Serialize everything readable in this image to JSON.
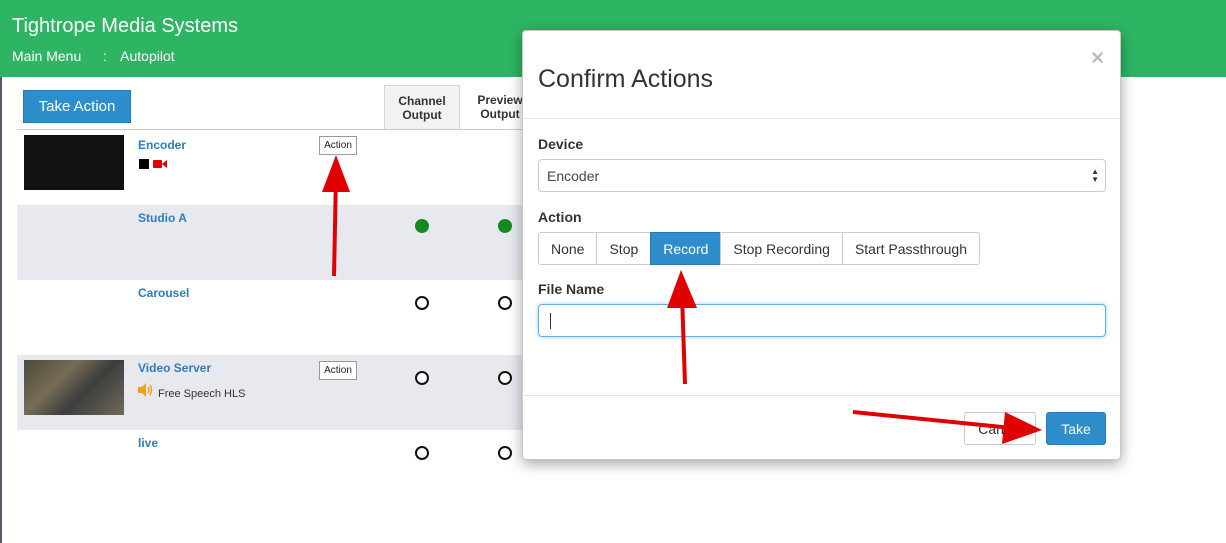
{
  "header": {
    "app_title": "Tightrope Media Systems",
    "breadcrumb": [
      "Main Menu",
      ":",
      "Autopilot"
    ]
  },
  "toolbar": {
    "take_action_label": "Take Action"
  },
  "columns": {
    "channel_output": "Channel Output",
    "preview_output": "Preview Output"
  },
  "devices": [
    {
      "name": "Encoder",
      "action_label": "Action",
      "channel": "",
      "preview": ""
    },
    {
      "name": "Studio A",
      "channel": "on",
      "preview": "on"
    },
    {
      "name": "Carousel",
      "channel": "off",
      "preview": "off"
    },
    {
      "name": "Video Server",
      "action_label": "Action",
      "source": "Free Speech HLS",
      "channel": "off",
      "preview": "off"
    },
    {
      "name": "live",
      "channel": "off",
      "preview": "off"
    }
  ],
  "modal": {
    "title": "Confirm Actions",
    "close_symbol": "×",
    "device_label": "Device",
    "device_value": "Encoder",
    "action_label": "Action",
    "actions": [
      "None",
      "Stop",
      "Record",
      "Stop Recording",
      "Start Passthrough"
    ],
    "selected_action": "Record",
    "file_name_label": "File Name",
    "file_name_value": "",
    "cancel_label": "Cancel",
    "take_label": "Take"
  },
  "colors": {
    "header_green": "#2db563",
    "primary_blue": "#2e8ecb",
    "device_name_blue": "#2f7dbd",
    "status_on_green": "#138a1e",
    "annotation_red": "#e00000"
  }
}
